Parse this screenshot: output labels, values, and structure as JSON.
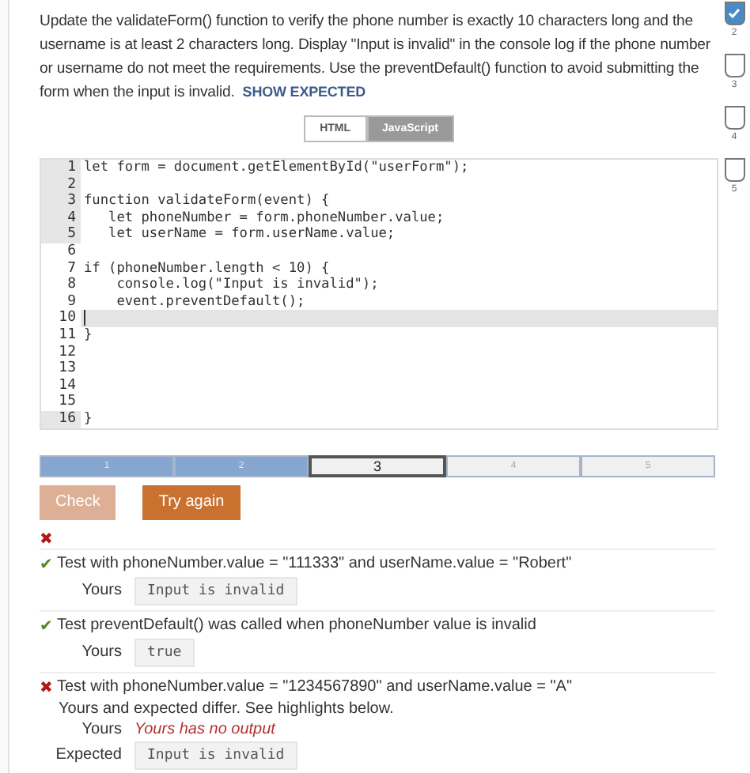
{
  "instructions": {
    "text": "Update the validateForm() function to verify the phone number is exactly 10 characters long and the username is at least 2 characters long. Display \"Input is invalid\" in the console log if the phone number or username do not meet the requirements. Use the preventDefault() function to avoid submitting the form when the input is invalid.",
    "link": "SHOW EXPECTED"
  },
  "side_checks": [
    {
      "label": "2",
      "checked": true
    },
    {
      "label": "3",
      "checked": false
    },
    {
      "label": "4",
      "checked": false
    },
    {
      "label": "5",
      "checked": false
    }
  ],
  "tabs": [
    {
      "label": "HTML",
      "selected": false
    },
    {
      "label": "JavaScript",
      "selected": true
    }
  ],
  "code": [
    {
      "number": "1",
      "text": "let form = document.getElementById(\"userForm\");",
      "readonly": true,
      "active": false
    },
    {
      "number": "2",
      "readonly": true,
      "active": false
    },
    {
      "number": "3",
      "text": "function validateForm(event) {",
      "readonly": true,
      "active": false
    },
    {
      "number": "4",
      "text": "   let phoneNumber = form.phoneNumber.value;",
      "readonly": true,
      "active": false
    },
    {
      "number": "5",
      "text": "   let userName = form.userName.value;",
      "readonly": true,
      "active": false
    },
    {
      "number": "6",
      "readonly": false,
      "active": false
    },
    {
      "number": "7",
      "text": "if (phoneNumber.length < 10) {",
      "readonly": false,
      "active": false
    },
    {
      "number": "8",
      "text": "    console.log(\"Input is invalid\");",
      "readonly": false,
      "active": false
    },
    {
      "number": "9",
      "text": "    event.preventDefault();",
      "readonly": false,
      "active": false
    },
    {
      "number": "10",
      "readonly": false,
      "active": true
    },
    {
      "number": "11",
      "text": "}",
      "readonly": false,
      "active": false
    },
    {
      "number": "12",
      "readonly": false,
      "active": false
    },
    {
      "number": "13",
      "readonly": false,
      "active": false
    },
    {
      "number": "14",
      "readonly": false,
      "active": false
    },
    {
      "number": "15",
      "readonly": false,
      "active": false
    },
    {
      "number": "16",
      "text": "}",
      "readonly": true,
      "active": false
    }
  ],
  "steps": [
    {
      "label": "1",
      "done": true,
      "selected": false
    },
    {
      "label": "2",
      "done": true,
      "selected": false
    },
    {
      "label": "3",
      "done": false,
      "selected": true
    },
    {
      "label": "4",
      "done": false,
      "selected": false
    },
    {
      "label": "5",
      "done": false,
      "selected": false
    }
  ],
  "buttons": [
    {
      "label": "Check",
      "disabled": true
    },
    {
      "label": "Try again",
      "disabled": false
    }
  ],
  "result_mark": "✖",
  "tests": [
    {
      "passed": true,
      "mark": "✔",
      "title": "Test with phoneNumber.value = \"111333\" and userName.value = \"Robert\"",
      "rows": [
        {
          "kind": "output",
          "label": "Yours",
          "value": "Input is invalid"
        }
      ]
    },
    {
      "passed": true,
      "mark": "✔",
      "title": "Test preventDefault() was called when phoneNumber value is invalid",
      "rows": [
        {
          "kind": "output",
          "label": "Yours",
          "value": "true"
        }
      ]
    },
    {
      "passed": false,
      "mark": "✖",
      "title": "Test with phoneNumber.value = \"1234567890\" and userName.value = \"A\"",
      "note": "Yours and expected differ. See highlights below.",
      "rows": [
        {
          "kind": "missing",
          "label": "Yours",
          "value": "Yours has no output"
        },
        {
          "kind": "output",
          "label": "Expected",
          "value": "Input is invalid"
        }
      ]
    }
  ]
}
